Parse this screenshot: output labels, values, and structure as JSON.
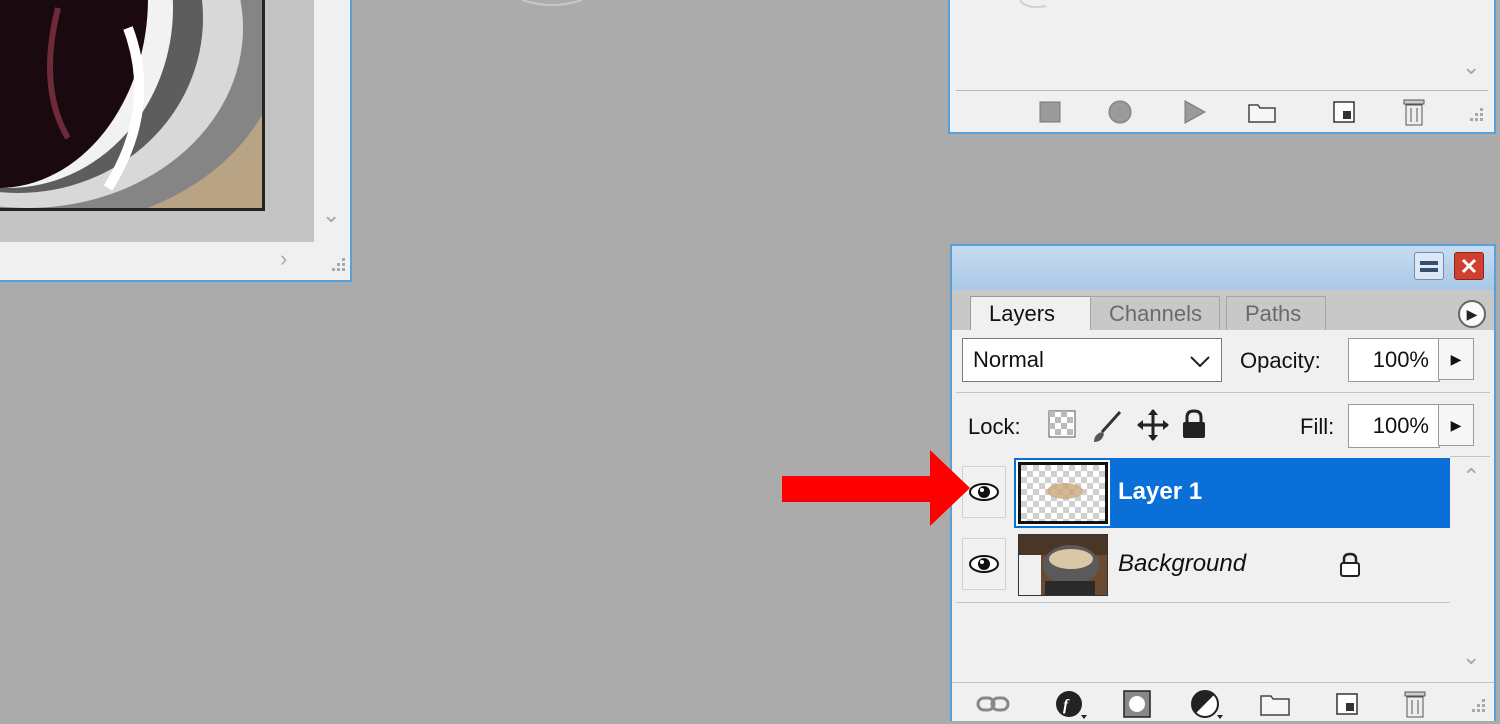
{
  "layers_panel": {
    "tabs": [
      {
        "label": "Layers",
        "active": true
      },
      {
        "label": "Channels",
        "active": false
      },
      {
        "label": "Paths",
        "active": false
      }
    ],
    "blend_mode": "Normal",
    "opacity_label": "Opacity:",
    "opacity_value": "100%",
    "lock_label": "Lock:",
    "fill_label": "Fill:",
    "fill_value": "100%",
    "layers": [
      {
        "name": "Layer 1",
        "selected": true,
        "visible": true,
        "locked": false
      },
      {
        "name": "Background",
        "selected": false,
        "visible": true,
        "locked": true
      }
    ],
    "colors": {
      "selection": "#0a6fd6",
      "titlebar": "#a9c7e6",
      "window_border": "#5aa0d8"
    }
  },
  "annotation": {
    "color": "#ff0000",
    "icon": "red-arrow-icon"
  },
  "workspace": {
    "background": "#ababab"
  }
}
